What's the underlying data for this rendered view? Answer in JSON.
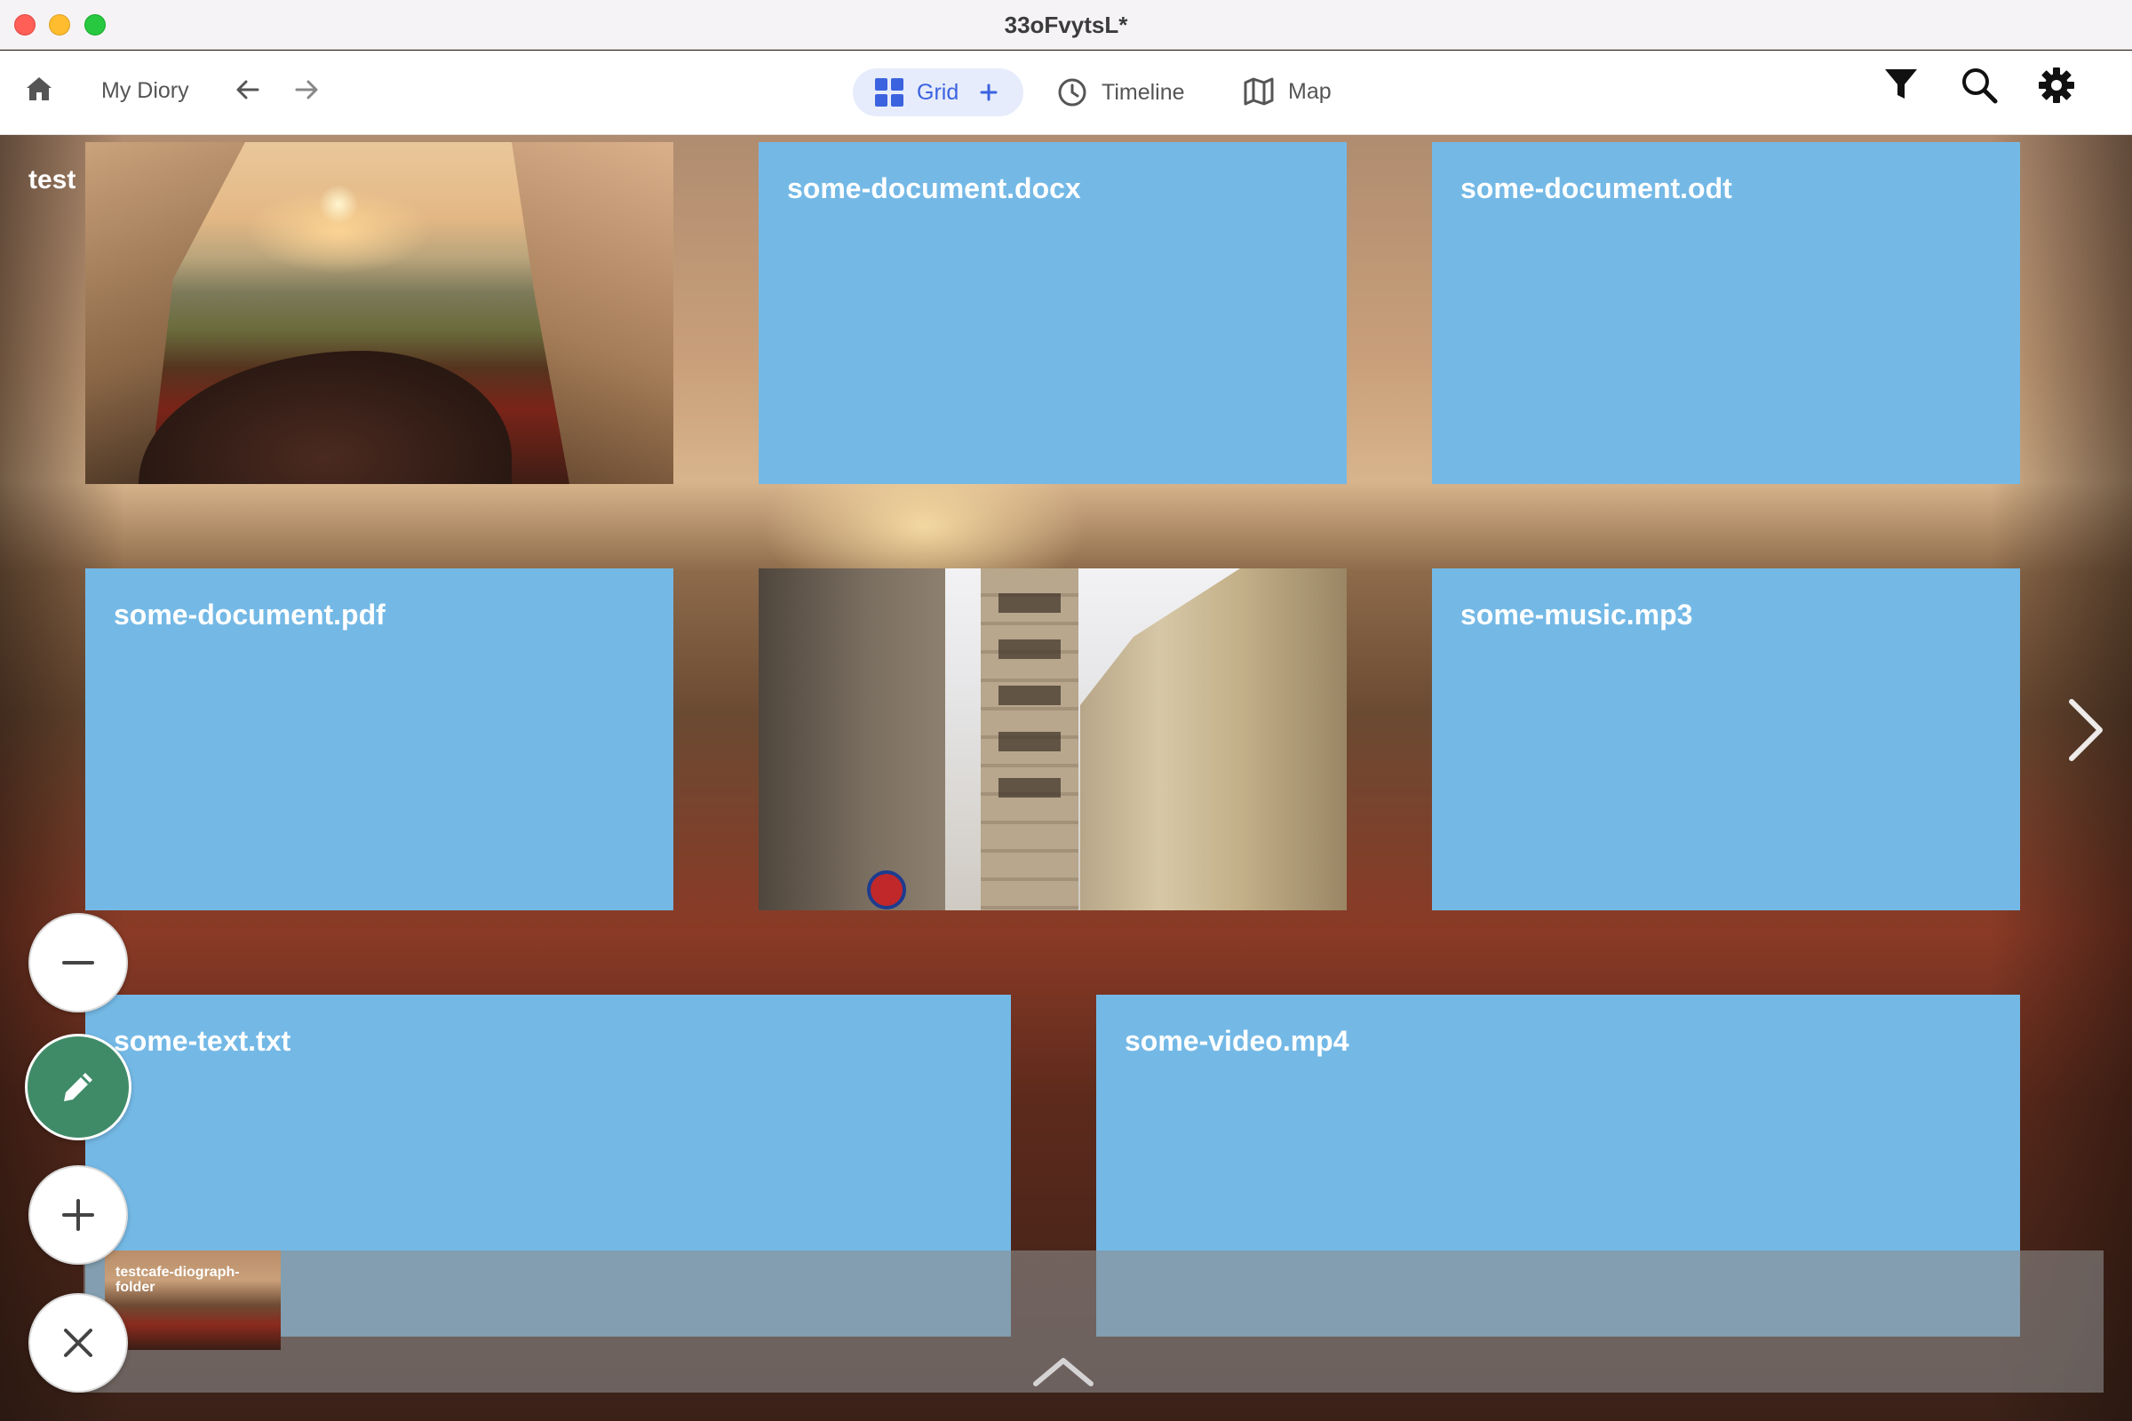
{
  "window": {
    "title": "33oFvytsL*"
  },
  "toolbar": {
    "diory_label": "My Diory",
    "grid_label": "Grid",
    "timeline_label": "Timeline",
    "map_label": "Map"
  },
  "content": {
    "bg_title": "test",
    "tiles": [
      {
        "label": "",
        "kind": "photo-sunset"
      },
      {
        "label": "some-document.docx"
      },
      {
        "label": "some-document.odt"
      },
      {
        "label": "some-document.pdf"
      },
      {
        "label": "",
        "kind": "photo-street"
      },
      {
        "label": "some-music.mp3"
      },
      {
        "label": "some-text.txt"
      },
      {
        "label": "some-video.mp4"
      }
    ],
    "story_thumb_label": "testcafe-diograph-folder"
  },
  "colors": {
    "tile_blue": "#74b9e6",
    "accent": "#3b63e0",
    "edit_green": "#3f8b68"
  },
  "icons": [
    "home-icon",
    "arrow-left-icon",
    "arrow-right-icon",
    "grid-icon",
    "plus-icon",
    "clock-icon",
    "map-icon",
    "filter-icon",
    "search-icon",
    "gear-icon",
    "minus-icon",
    "pencil-icon",
    "close-icon",
    "chevron-right-icon",
    "chevron-up-icon"
  ]
}
